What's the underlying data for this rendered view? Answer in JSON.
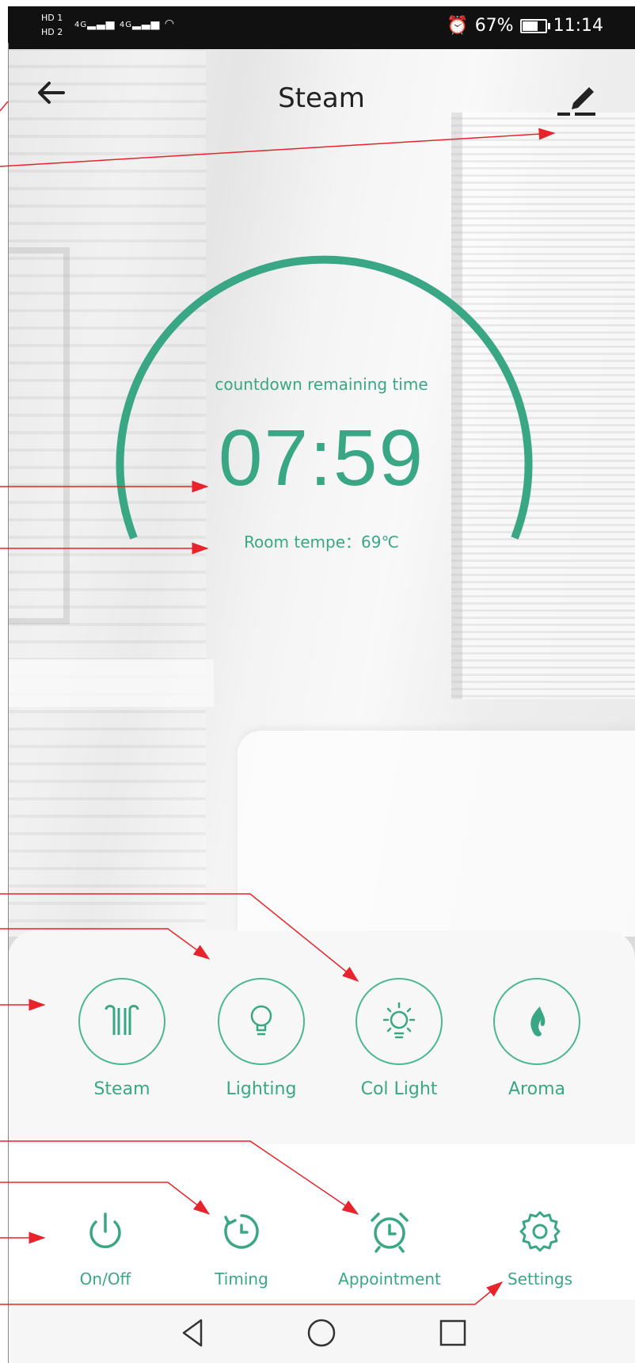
{
  "status_bar": {
    "hd1": "HD 1",
    "hd2": "HD 2",
    "signal1": "4G",
    "signal2": "4G",
    "battery_percent": "67%",
    "battery_level": 0.67,
    "time": "11:14",
    "icons": [
      "hd-icon",
      "signal-icon",
      "wifi-icon",
      "alarm-icon",
      "battery-icon"
    ]
  },
  "header": {
    "title": "Steam",
    "back_icon": "arrow-left-icon",
    "edit_icon": "pen-icon"
  },
  "gauge": {
    "label": "countdown remaining time",
    "time": "07:59",
    "room_temp": "Room tempe：69℃",
    "accent": "#3aa784"
  },
  "functions": [
    {
      "label": "Steam",
      "icon": "steam-icon"
    },
    {
      "label": "Lighting",
      "icon": "bulb-icon"
    },
    {
      "label": "Col Light",
      "icon": "sun-icon"
    },
    {
      "label": "Aroma",
      "icon": "flame-icon"
    }
  ],
  "actions": [
    {
      "label": "On/Off",
      "icon": "power-icon"
    },
    {
      "label": "Timing",
      "icon": "timer-icon"
    },
    {
      "label": "Appointment",
      "icon": "alarm-clock-icon"
    },
    {
      "label": "Settings",
      "icon": "gear-icon"
    }
  ],
  "colors": {
    "accent": "#3aa784",
    "annotation": "#e8232b"
  }
}
